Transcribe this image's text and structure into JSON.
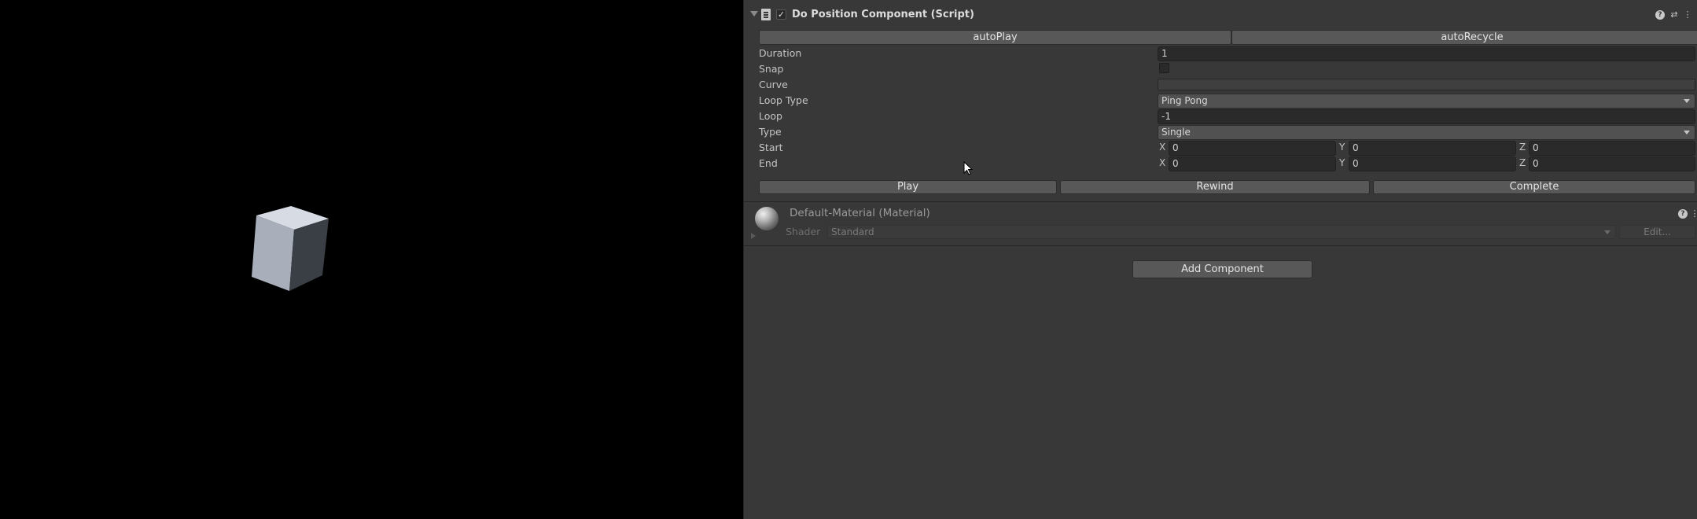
{
  "component": {
    "title": "Do Position Component (Script)",
    "enabled_mark": "✓"
  },
  "toggles": {
    "auto_play": "autoPlay",
    "auto_recycle": "autoRecycle"
  },
  "fields": {
    "duration": {
      "label": "Duration",
      "value": "1"
    },
    "snap": {
      "label": "Snap",
      "checked": false
    },
    "curve": {
      "label": "Curve"
    },
    "loop_type": {
      "label": "Loop Type",
      "value": "Ping Pong"
    },
    "loop": {
      "label": "Loop",
      "value": "-1"
    },
    "type": {
      "label": "Type",
      "value": "Single"
    },
    "start": {
      "label": "Start",
      "x": "0",
      "y": "0",
      "z": "0"
    },
    "end": {
      "label": "End",
      "x": "0",
      "y": "0",
      "z": "0"
    }
  },
  "axes": {
    "x": "X",
    "y": "Y",
    "z": "Z"
  },
  "actions": {
    "play": "Play",
    "rewind": "Rewind",
    "complete": "Complete"
  },
  "material": {
    "title": "Default-Material (Material)",
    "shader_label": "Shader",
    "shader_value": "Standard",
    "edit": "Edit..."
  },
  "add_component": "Add Component",
  "icons": {
    "foldout": "foldout-arrow-icon",
    "script": "script-icon",
    "help": "help-icon",
    "preset": "preset-icon",
    "menu": "kebab-menu-icon",
    "material": "material-sphere-icon"
  },
  "colors": {
    "inspector_bg": "#383838",
    "viewport_bg": "#000000",
    "field_bg": "#2a2a2a",
    "button_bg": "#585858"
  }
}
